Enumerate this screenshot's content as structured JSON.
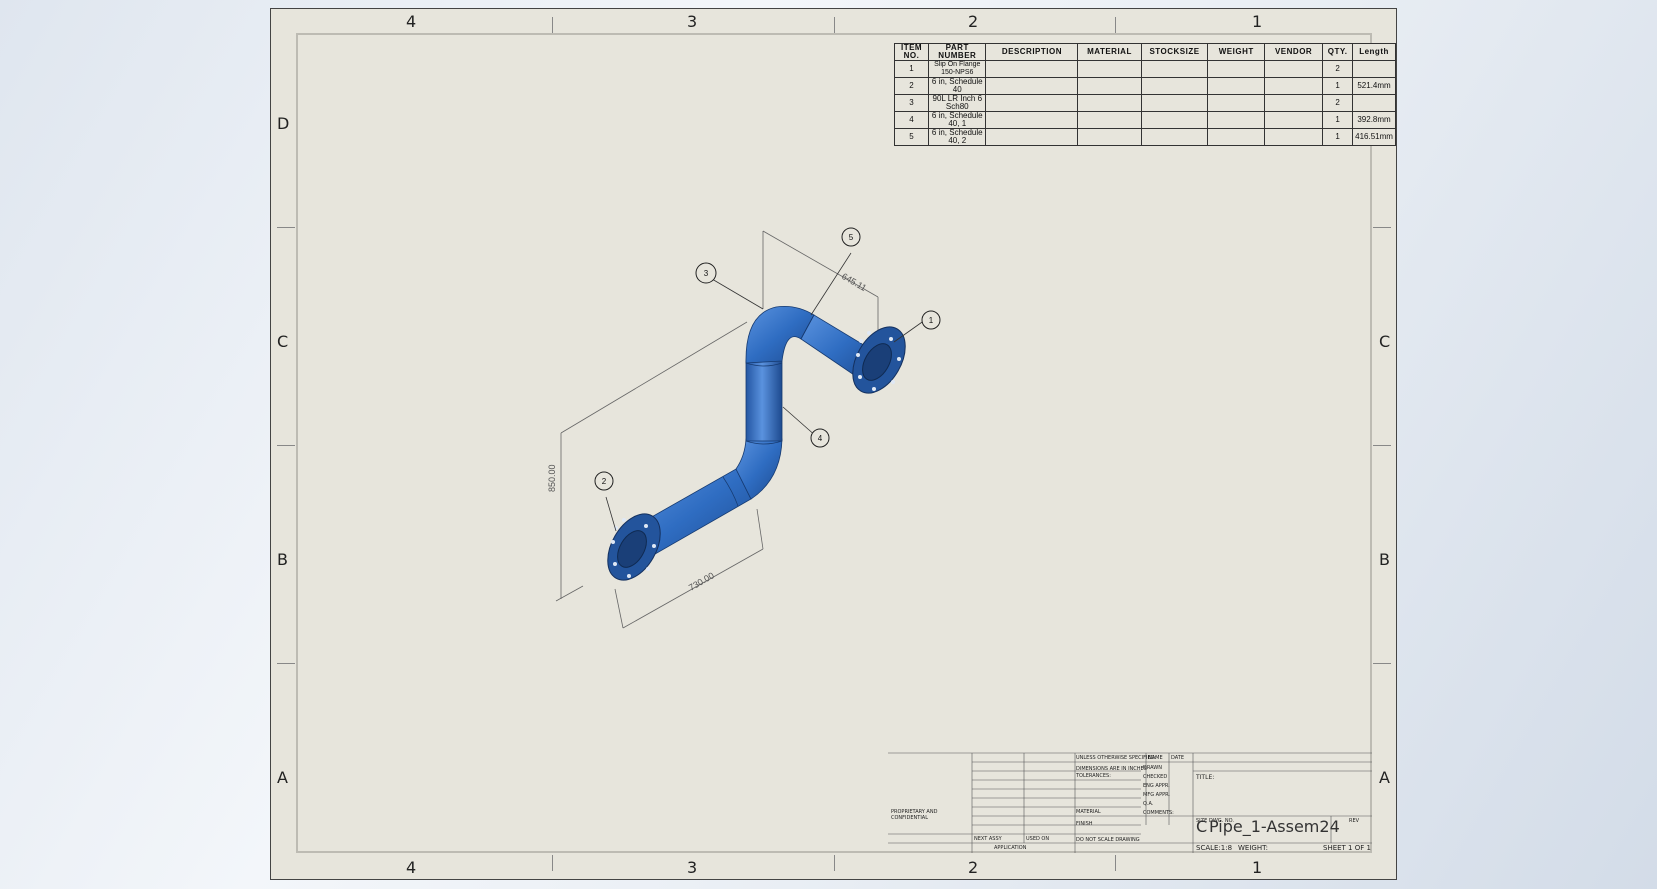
{
  "sheet": {
    "zones_top": [
      "4",
      "3",
      "2",
      "1"
    ],
    "zones_bottom": [
      "4",
      "3",
      "2",
      "1"
    ],
    "zones_left": [
      "D",
      "C",
      "B",
      "A"
    ],
    "zones_right": [
      "D",
      "C",
      "B",
      "A"
    ]
  },
  "bom": {
    "headers": [
      "ITEM NO.",
      "PART NUMBER",
      "DESCRIPTION",
      "MATERIAL",
      "STOCKSIZE",
      "WEIGHT",
      "VENDOR",
      "QTY.",
      "Length"
    ],
    "rows": [
      {
        "item": "1",
        "part": "Slip On Flange 150-NPS6",
        "qty": "2",
        "length": ""
      },
      {
        "item": "2",
        "part": "6 in, Schedule 40",
        "qty": "1",
        "length": "521.4mm"
      },
      {
        "item": "3",
        "part": "90L LR Inch 6 Sch80",
        "qty": "2",
        "length": ""
      },
      {
        "item": "4",
        "part": "6 in, Schedule 40, 1",
        "qty": "1",
        "length": "392.8mm"
      },
      {
        "item": "5",
        "part": "6 in, Schedule 40, 2",
        "qty": "1",
        "length": "416.51mm"
      }
    ]
  },
  "balloons": [
    "1",
    "2",
    "3",
    "4",
    "5"
  ],
  "dimensions": {
    "vertical": "850.00",
    "top": "645.11",
    "bottom": "730.00"
  },
  "title_block": {
    "proprietary": "PROPRIETARY AND CONFIDENTIAL",
    "unless": "UNLESS OTHERWISE SPECIFIED:",
    "dims": "DIMENSIONS ARE IN INCHES",
    "tol": "TOLERANCES:",
    "name": "NAME",
    "date": "DATE",
    "drawn": "DRAWN",
    "checked": "CHECKED",
    "eng_appr": "ENG APPR.",
    "mfg_appr": "MFG APPR.",
    "qa": "Q.A.",
    "comments": "COMMENTS:",
    "material": "MATERIAL",
    "finish": "FINISH",
    "next_assy": "NEXT ASSY",
    "used_on": "USED ON",
    "application": "APPLICATION",
    "do_not_scale": "DO NOT SCALE DRAWING",
    "title": "TITLE:",
    "size_label": "SIZE",
    "size": "C",
    "dwg_no_label": "DWG. NO.",
    "dwg_no": "Pipe_1-Assem24",
    "rev": "REV",
    "scale": "SCALE:1:8",
    "weight": "WEIGHT:",
    "sheet": "SHEET 1 OF 1"
  },
  "colors": {
    "pipe": "#2f6dc2",
    "pipe_dark": "#1d4a8f",
    "sheet": "#e7e5dc"
  }
}
